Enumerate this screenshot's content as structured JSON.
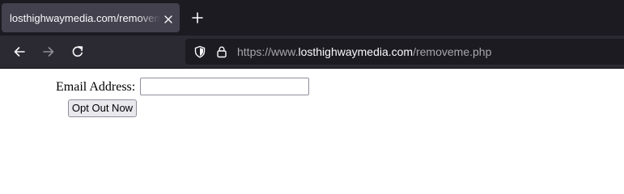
{
  "browser": {
    "tab": {
      "title": "losthighwaymedia.com/removeme.php",
      "close_icon": "close-icon"
    },
    "new_tab_icon": "plus-icon",
    "nav": {
      "back_icon": "arrow-left-icon",
      "forward_icon": "arrow-right-icon",
      "reload_icon": "reload-icon"
    },
    "url": {
      "prefix": "https://www.",
      "domain": "losthighwaymedia.com",
      "path": "/removeme.php",
      "shield_icon": "shield-icon",
      "lock_icon": "lock-icon"
    },
    "colors": {
      "tabstrip_bg": "#1c1b22",
      "active_tab_bg": "#42414d",
      "navbar_bg": "#2b2a33",
      "urlbar_bg": "#1c1b22",
      "text": "#fbfbfe",
      "dim_text": "#a6a6ad"
    }
  },
  "page": {
    "email_label": "Email Address:",
    "email_value": "",
    "submit_label": "Opt Out Now"
  }
}
